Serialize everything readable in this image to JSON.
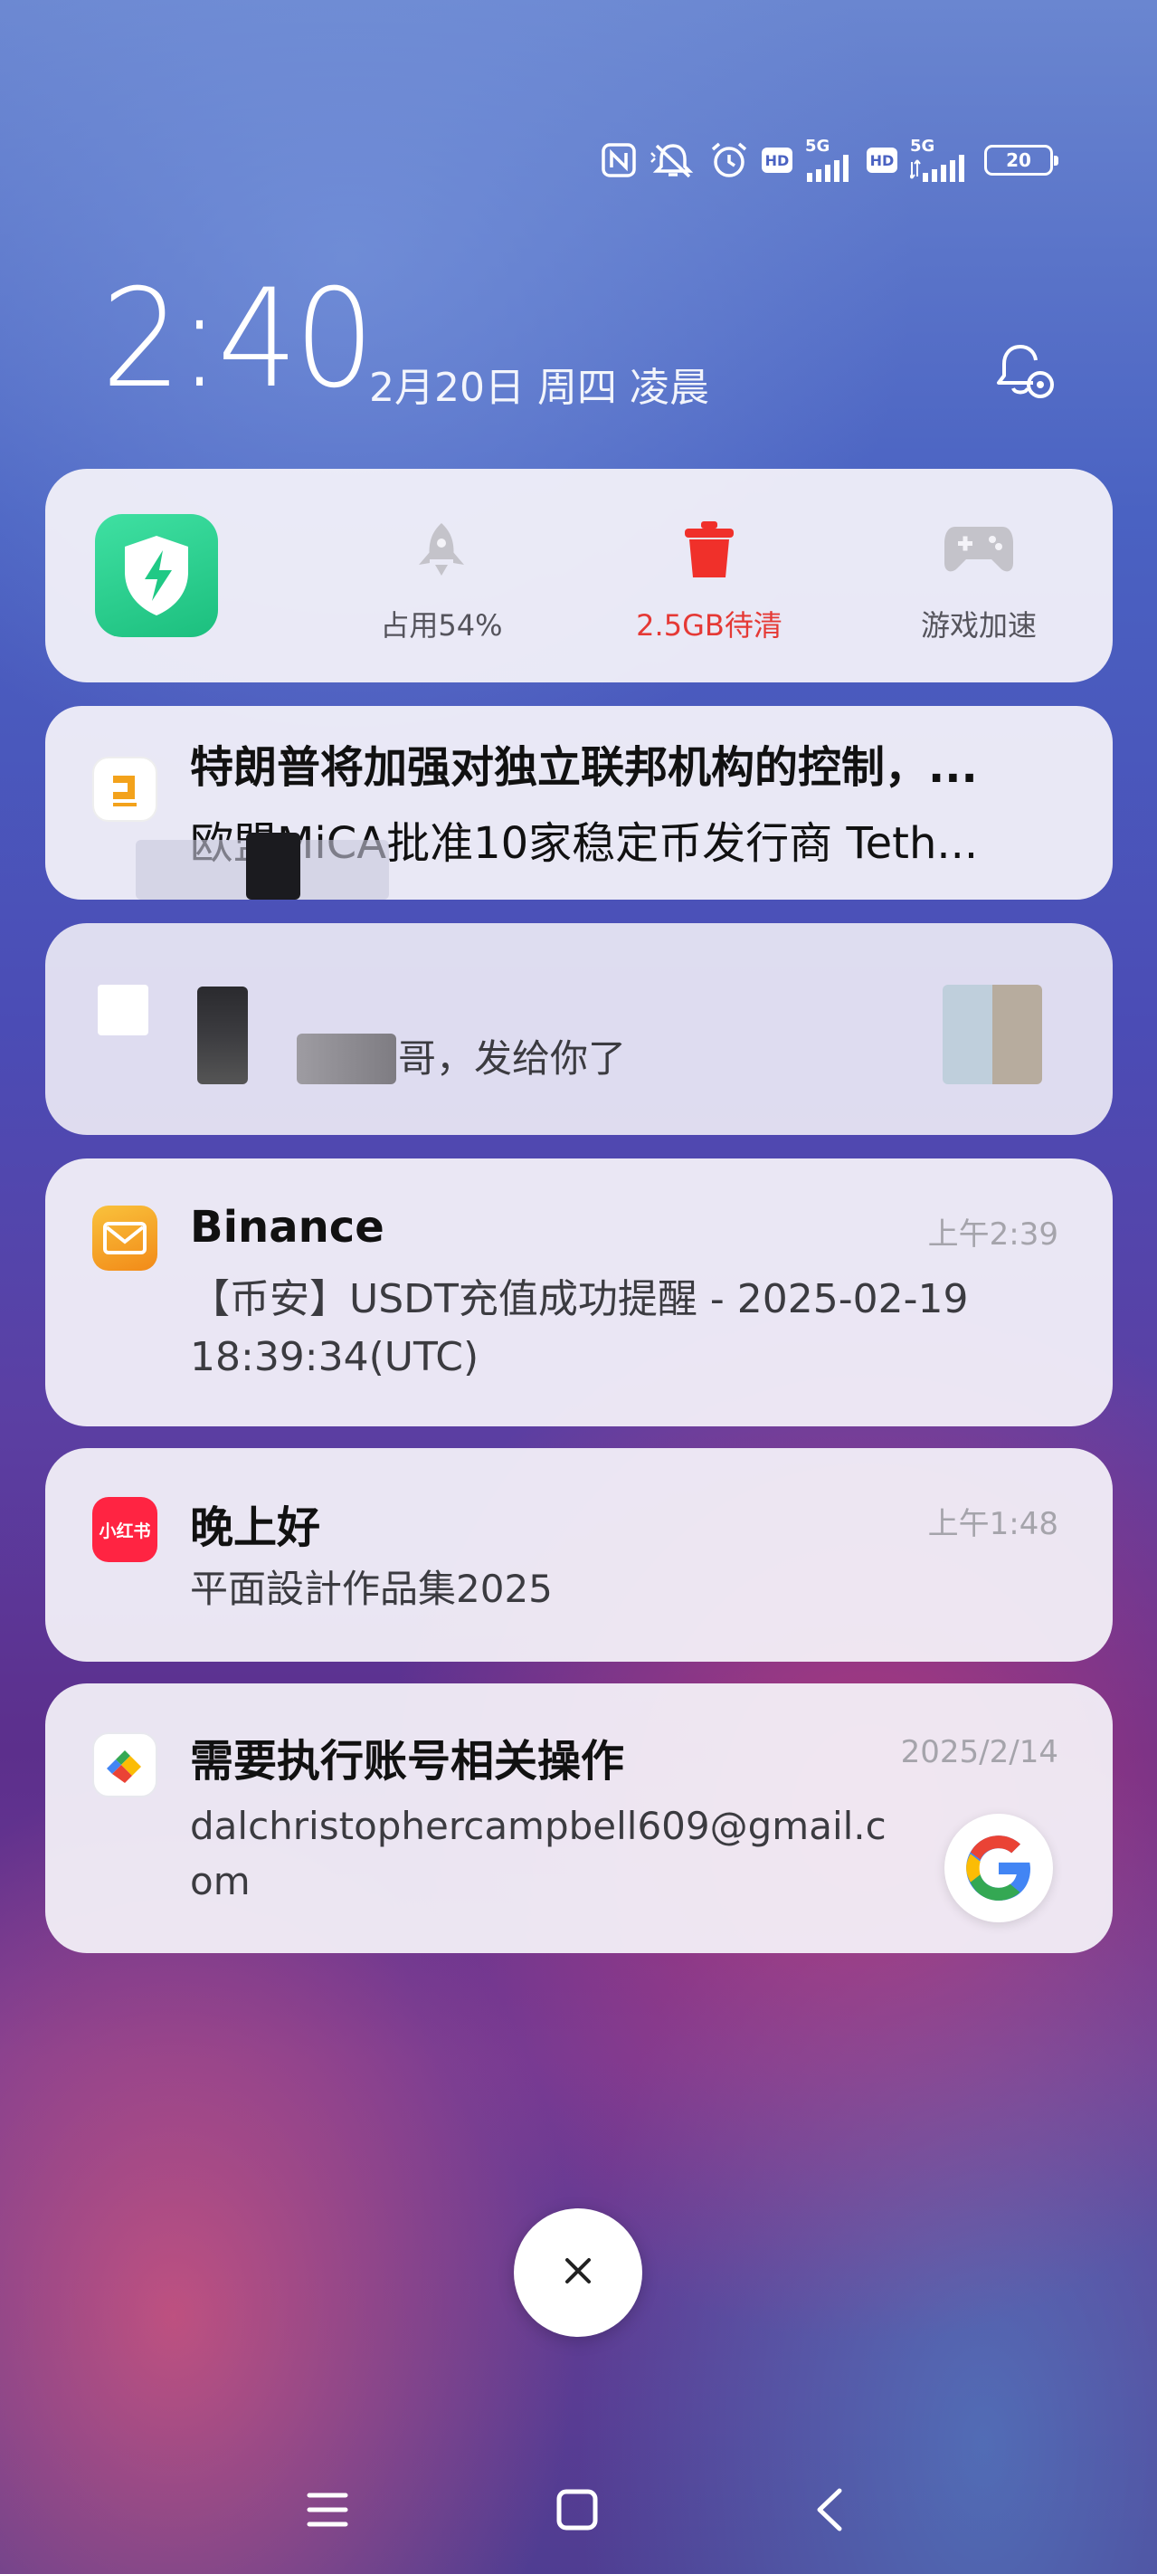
{
  "status_bar": {
    "icons": [
      "nfc-icon",
      "mute-icon",
      "alarm-icon",
      "hd-icon",
      "signal-icon",
      "hd-icon",
      "signal-icon",
      "battery-icon"
    ],
    "hd_label": "HD",
    "network_label": "5G",
    "battery_level": "20"
  },
  "clock": {
    "time": "2:40",
    "date": "2月20日 周四 凌晨"
  },
  "security_panel": {
    "items": [
      {
        "label": "占用54%",
        "icon": "rocket-icon"
      },
      {
        "label": "2.5GB待清",
        "icon": "trash-icon",
        "color": "#e53935"
      },
      {
        "label": "游戏加速",
        "icon": "gamepad-icon"
      }
    ]
  },
  "notifications": [
    {
      "app_icon": "news-icon",
      "title": "特朗普将加强对独立联邦机构的控制，...",
      "body": "欧盟MiCA批准10家稳定币发行商 Teth..."
    },
    {
      "app_icon": "chat-icon",
      "body": "哥，发给你了"
    },
    {
      "app_icon": "mail-icon",
      "title": "Binance",
      "time": "上午2:39",
      "body": "【币安】USDT充值成功提醒 - 2025-02-19 18:39:34(UTC)"
    },
    {
      "app_icon": "xiaohongshu-icon",
      "app_icon_label": "小红书",
      "title": "晚上好",
      "time": "上午1:48",
      "body": "平面設計作品集2025"
    },
    {
      "app_icon": "play-services-icon",
      "title": "需要执行账号相关操作",
      "time": "2025/2/14",
      "body": "dalchristophercampbell609@gmail.com"
    }
  ],
  "colors": {
    "shield": "#20c985",
    "trash": "#f0302a",
    "mail": "#f6a623",
    "xiaohongshu": "#ff2442"
  }
}
